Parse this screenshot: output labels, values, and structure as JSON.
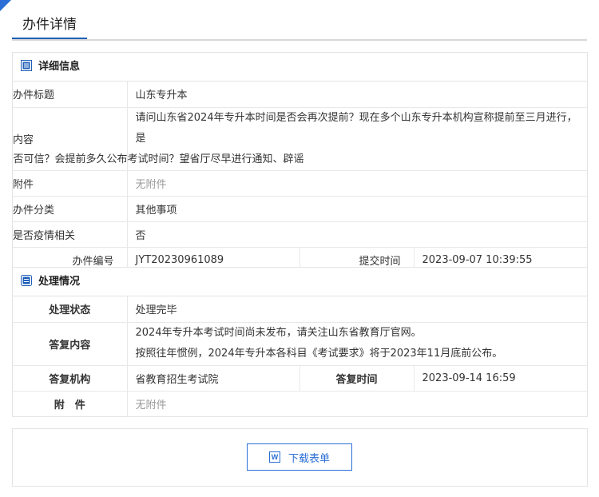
{
  "page_title": "办件详情",
  "detail": {
    "heading": "详细信息",
    "title_label": "办件标题",
    "title_value": "山东专升本",
    "content_label": "内容",
    "content_line1": "请问山东省2024年专升本时间是否会再次提前？现在多个山东专升本机构宣称提前至三月进行，是",
    "content_line2": "否可信？会提前多久公布考试时间？望省厅尽早进行通知、辟谣",
    "attachment_label": "附件",
    "attachment_value": "无附件",
    "category_label": "办件分类",
    "category_value": "其他事项",
    "epidemic_label": "是否疫情相关",
    "epidemic_value": "否",
    "number_label": "办件编号",
    "number_value": "JYT20230961089",
    "submit_label": "提交时间",
    "submit_value": "2023-09-07 10:39:55"
  },
  "handling": {
    "heading": "处理情况",
    "status_label": "处理状态",
    "status_value": "处理完毕",
    "reply_label": "答复内容",
    "reply_line1": "2024年专升本考试时间尚未发布，请关注山东省教育厅官网。",
    "reply_line2": "按照往年惯例，2024年专升本各科目《考试要求》将于2023年11月底前公布。",
    "org_label": "答复机构",
    "org_value": "省教育招生考试院",
    "reply_time_label": "答复时间",
    "reply_time_value": "2023-09-14 16:59",
    "attachment_label": "附　件",
    "attachment_value": "无附件"
  },
  "download_button": "下载表单",
  "colors": {
    "accent": "#2b6fd6",
    "title_underline": "#1f5fb8",
    "border": "#e3e3e3"
  }
}
